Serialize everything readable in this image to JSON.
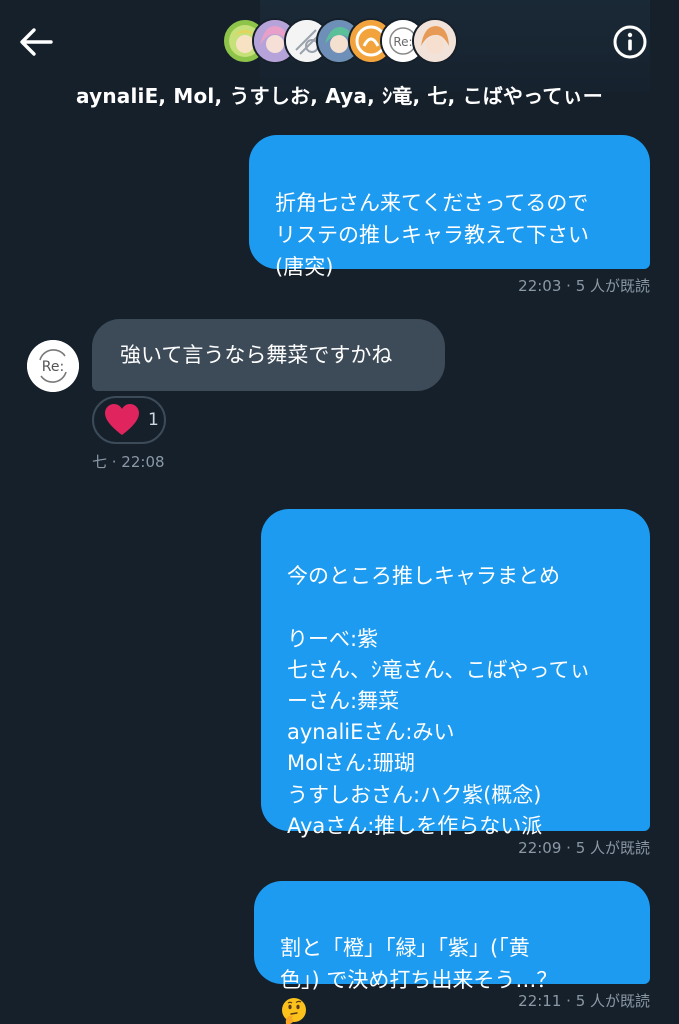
{
  "header": {
    "title": "aynaliE, Mol, うすしお, Aya, ｼ竜, 七, こばやってぃー",
    "back_icon": "arrow-left-icon",
    "info_icon": "info-icon",
    "participant_avatars": [
      {
        "color": "#8fc44a"
      },
      {
        "color": "#d6a4c8"
      },
      {
        "color": "#f2f2f2"
      },
      {
        "color": "#6fa38a"
      },
      {
        "color": "#f0a24a"
      },
      {
        "color": "#ffffff"
      },
      {
        "color": "#e8b89a"
      }
    ]
  },
  "messages": [
    {
      "direction": "outgoing",
      "text": "折角七さん来てくださってるので\nリステの推しキャラ教えて下さい\n(唐突)",
      "meta": "22:03 · 5 人が既読"
    },
    {
      "direction": "incoming",
      "text": "強いて言うなら舞菜ですかね",
      "reaction": {
        "emoji": "heart-icon",
        "count": "1"
      },
      "meta": "七 · 22:08"
    },
    {
      "direction": "outgoing",
      "text": "今のところ推しキャラまとめ\n\nりーべ:紫\n七さん、ｼ竜さん、こばやってぃ\nーさん:舞菜\naynaliEさん:みい\nMolさん:珊瑚\nうすしおさん:ハク紫(概念)\nAyaさん:推しを作らない派",
      "meta": "22:09 · 5 人が既読"
    },
    {
      "direction": "outgoing",
      "text": "割と「橙」「緑」「紫」(「黄\n色」) で決め打ち出来そう…？",
      "emoji": "thinking-face-icon",
      "meta": "22:11 · 5 人が既読"
    }
  ],
  "colors": {
    "background": "#15202b",
    "outgoing_bubble": "#1d9bf0",
    "incoming_bubble": "#3d4b59",
    "meta_text": "#8b98a5",
    "heart": "#e0245e"
  }
}
